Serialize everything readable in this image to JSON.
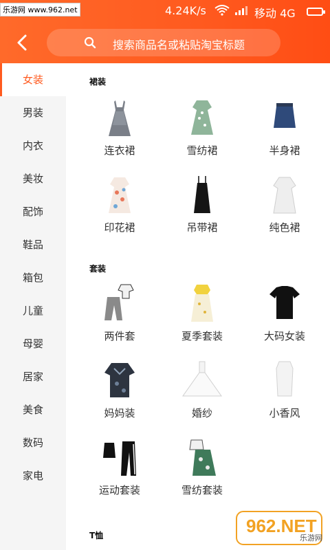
{
  "statusbar": {
    "watermark": "乐游网 www.962.net",
    "net_speed": "4.24K/s",
    "carrier": "移动 4G"
  },
  "header": {
    "search_placeholder": "搜索商品名或粘贴淘宝标题"
  },
  "sidebar": {
    "items": [
      {
        "label": "女装",
        "active": true
      },
      {
        "label": "男装"
      },
      {
        "label": "内衣"
      },
      {
        "label": "美妆"
      },
      {
        "label": "配饰"
      },
      {
        "label": "鞋品"
      },
      {
        "label": "箱包"
      },
      {
        "label": "儿童"
      },
      {
        "label": "母婴"
      },
      {
        "label": "居家"
      },
      {
        "label": "美食"
      },
      {
        "label": "数码"
      },
      {
        "label": "家电"
      }
    ]
  },
  "sections": [
    {
      "title": "裙装",
      "items": [
        {
          "label": "连衣裙",
          "icon": "dress-icon"
        },
        {
          "label": "雪纺裙",
          "icon": "chiffon-dress-icon"
        },
        {
          "label": "半身裙",
          "icon": "skirt-icon"
        },
        {
          "label": "印花裙",
          "icon": "print-dress-icon"
        },
        {
          "label": "吊带裙",
          "icon": "slip-dress-icon"
        },
        {
          "label": "纯色裙",
          "icon": "solid-dress-icon"
        }
      ]
    },
    {
      "title": "套装",
      "items": [
        {
          "label": "两件套",
          "icon": "two-piece-icon"
        },
        {
          "label": "夏季套装",
          "icon": "summer-set-icon"
        },
        {
          "label": "大码女装",
          "icon": "plus-size-icon"
        },
        {
          "label": "妈妈装",
          "icon": "mom-wear-icon"
        },
        {
          "label": "婚纱",
          "icon": "wedding-dress-icon"
        },
        {
          "label": "小香风",
          "icon": "tweed-style-icon"
        },
        {
          "label": "运动套装",
          "icon": "sport-set-icon"
        },
        {
          "label": "雪纺套装",
          "icon": "chiffon-set-icon"
        }
      ]
    },
    {
      "title": "T恤",
      "items": []
    }
  ],
  "watermark_logo": {
    "text": "962.NET",
    "subtext": "乐游网"
  },
  "colors": {
    "accent": "#ff5a1f",
    "sidebar_bg": "#f5f5f5"
  }
}
